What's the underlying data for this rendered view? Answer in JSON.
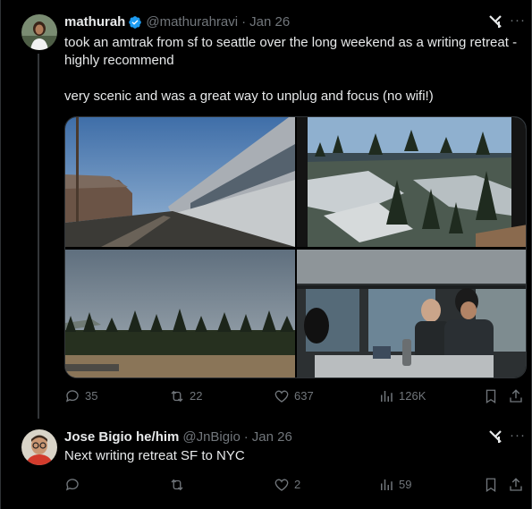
{
  "tweet1": {
    "name": "mathurah",
    "handle": "@mathurahravi",
    "sep": "·",
    "date": "Jan 26",
    "text": "took an amtrak from sf to seattle over the long weekend as a writing retreat - highly recommend\n\nvery scenic and was a great way to unplug and focus (no wifi!)",
    "replies": "35",
    "reposts": "22",
    "likes": "637",
    "views": "126K"
  },
  "tweet2": {
    "name": "Jose Bigio he/him",
    "handle": "@JnBigio",
    "sep": "·",
    "date": "Jan 26",
    "text": "Next writing retreat SF to NYC",
    "replies": "",
    "reposts": "",
    "likes": "2",
    "views": "59"
  },
  "icons": [
    "grok-icon",
    "more-icon",
    "verified-icon",
    "reply-icon",
    "repost-icon",
    "like-icon",
    "views-icon",
    "bookmark-icon",
    "share-icon"
  ],
  "colors": {
    "background": "#000000",
    "text": "#e7e9ea",
    "muted": "#71767b",
    "verified": "#1d9bf0",
    "border": "#2f3336"
  }
}
